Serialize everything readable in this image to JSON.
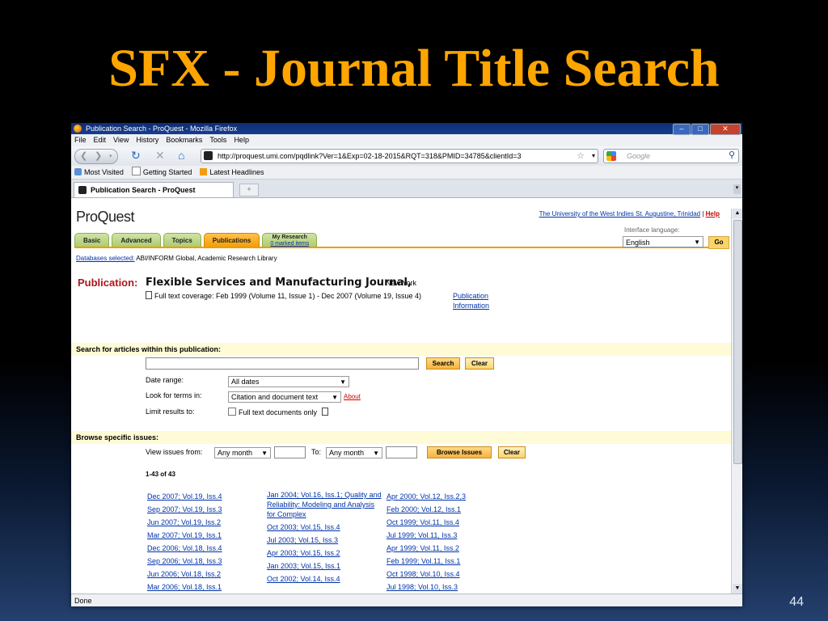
{
  "slide": {
    "title": "SFX - Journal Title Search",
    "page_number": "44"
  },
  "browser": {
    "window_title": "Publication Search - ProQuest - Mozilla Firefox",
    "menu": [
      "File",
      "Edit",
      "View",
      "History",
      "Bookmarks",
      "Tools",
      "Help"
    ],
    "url": "http://proquest.umi.com/pqdlink?Ver=1&Exp=02-18-2015&RQT=318&PMID=34785&clientId=3",
    "search_placeholder": "Google",
    "bookmarks": [
      "Most Visited",
      "Getting Started",
      "Latest Headlines"
    ],
    "tab_title": "Publication Search - ProQuest",
    "status": "Done"
  },
  "page": {
    "logo": "ProQuest",
    "institution": "The University of the West Indies St. Augustine, Trinidad",
    "help": "Help",
    "separator": "|",
    "tabs": [
      "Basic",
      "Advanced",
      "Topics",
      "Publications"
    ],
    "my_research": {
      "label": "My Research",
      "sub": "0 marked items"
    },
    "interface_language_label": "Interface language:",
    "interface_language": "English",
    "go": "Go",
    "databases_selected_label": "Databases selected:",
    "databases": "ABI/INFORM Global, Academic Research Library",
    "publication_label": "Publication:",
    "publication_title": "Flexible Services and Manufacturing Journal,",
    "publication_location": "New York",
    "coverage": "Full text coverage: Feb 1999 (Volume 11, Issue 1) - Dec 2007 (Volume 19, Issue 4)",
    "publication_info_line1": "Publication",
    "publication_info_line2": "Information"
  },
  "search_section": {
    "heading": "Search for articles within this publication:",
    "search_button": "Search",
    "clear_button": "Clear",
    "date_range_label": "Date range:",
    "date_range_value": "All dates",
    "look_for_label": "Look for terms in:",
    "look_for_value": "Citation and document text",
    "about": "About",
    "limit_label": "Limit results to:",
    "limit_option": "Full text documents only"
  },
  "browse_section": {
    "heading": "Browse specific issues:",
    "view_from_label": "View issues from:",
    "month_from": "Any month",
    "to_label": "To:",
    "month_to": "Any month",
    "browse_button": "Browse Issues",
    "clear_button": "Clear",
    "count": "1-43 of 43"
  },
  "issues": {
    "col1": [
      "Dec 2007; Vol.19, Iss.4",
      "Sep 2007; Vol.19, Iss.3",
      "Jun 2007; Vol.19, Iss.2",
      "Mar 2007; Vol.19, Iss.1",
      "Dec 2006; Vol.18, Iss.4",
      "Sep 2006; Vol.18, Iss.3",
      "Jun 2006; Vol.18, Iss.2",
      "Mar 2006; Vol.18, Iss.1"
    ],
    "col2_first": "Jan 2004; Vol.16, Iss.1; Quality and Reliability: Modeling and Analysis for Complex",
    "col2": [
      "Oct 2003; Vol.15, Iss.4",
      "Jul 2003; Vol.15, Iss.3",
      "Apr 2003; Vol.15, Iss.2",
      "Jan 2003; Vol.15, Iss.1",
      "Oct 2002; Vol.14, Iss.4"
    ],
    "col3": [
      "Apr 2000; Vol.12, Iss.2,3",
      "Feb 2000; Vol.12, Iss.1",
      "Oct 1999; Vol.11, Iss.4",
      "Jul 1999; Vol.11, Iss.3",
      "Apr 1999; Vol.11, Iss.2",
      "Feb 1999; Vol.11, Iss.1",
      "Oct 1998; Vol.10, Iss.4",
      "Jul 1998; Vol.10, Iss.3"
    ]
  }
}
